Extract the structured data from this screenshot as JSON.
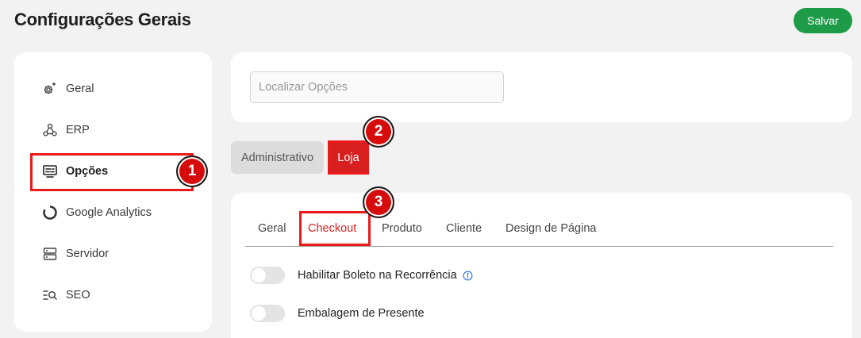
{
  "header": {
    "title": "Configurações Gerais",
    "save_label": "Salvar"
  },
  "sidebar": {
    "items": [
      {
        "label": "Geral",
        "icon": "gear-sparkle-icon"
      },
      {
        "label": "ERP",
        "icon": "webhook-icon"
      },
      {
        "label": "Opções",
        "icon": "options-monitor-icon"
      },
      {
        "label": "Google Analytics",
        "icon": "analytics-ring-icon"
      },
      {
        "label": "Servidor",
        "icon": "server-icon"
      },
      {
        "label": "SEO",
        "icon": "seo-search-icon"
      }
    ],
    "active": "Opções"
  },
  "search": {
    "placeholder": "Localizar Opções",
    "value": ""
  },
  "scope_pills": {
    "admin": "Administrativo",
    "loja": "Loja",
    "active": "Loja"
  },
  "tabs": {
    "items": [
      "Geral",
      "Checkout",
      "Produto",
      "Cliente",
      "Design de Página"
    ],
    "active": "Checkout"
  },
  "options": [
    {
      "label": "Habilitar Boleto na Recorrência",
      "enabled": false,
      "has_info": true
    },
    {
      "label": "Embalagem de Presente",
      "enabled": false,
      "has_info": false
    }
  ],
  "annotations": [
    "1",
    "2",
    "3"
  ],
  "colors": {
    "accent": "#d71f1f",
    "save": "#1e9b47",
    "highlight": "#ea1a1a",
    "info": "#2f6fd6"
  }
}
